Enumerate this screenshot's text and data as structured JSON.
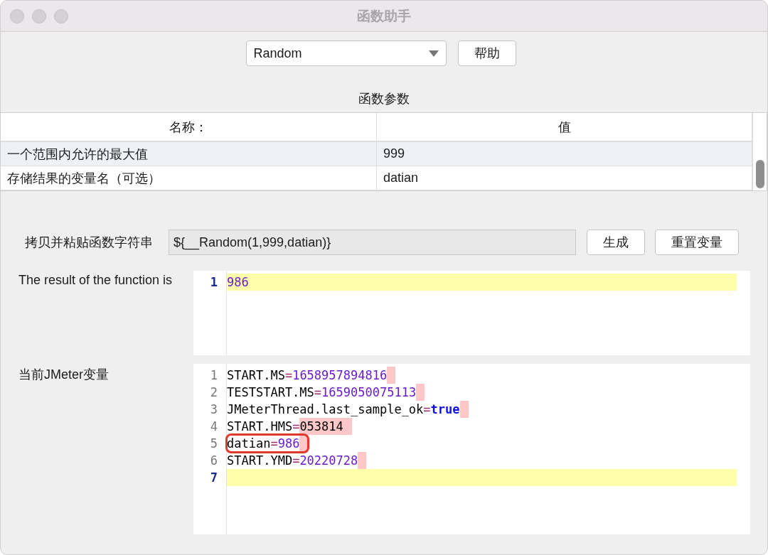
{
  "window": {
    "title": "函数助手"
  },
  "function_select": {
    "value": "Random"
  },
  "help_button": "帮助",
  "parameters": {
    "title": "函数参数",
    "columns": [
      "名称：",
      "值"
    ],
    "rows": [
      {
        "name": "一个范围内允许的最大值",
        "value": "999",
        "selected": true
      },
      {
        "name": "存储结果的变量名（可选）",
        "value": "datian",
        "selected": false
      }
    ]
  },
  "function_string": {
    "label": "拷贝并粘贴函数字符串",
    "value": "${__Random(1,999,datian)}"
  },
  "generate_button": "生成",
  "reset_button": "重置变量",
  "result": {
    "label": "The result of the function is",
    "lines": [
      {
        "number": "1",
        "value": "986",
        "kind": "number",
        "current": true,
        "trailing_space": false,
        "circled": false
      }
    ]
  },
  "variables": {
    "label": "当前JMeter变量",
    "lines": [
      {
        "number": "1",
        "key": "START.MS",
        "sep": "=",
        "value": "1658957894816",
        "kind": "number",
        "current": false,
        "trailing_space": true,
        "circled": false
      },
      {
        "number": "2",
        "key": "TESTSTART.MS",
        "sep": "=",
        "value": "1659050075113",
        "kind": "number",
        "current": false,
        "trailing_space": true,
        "circled": false
      },
      {
        "number": "3",
        "key": "JMeterThread.last_sample_ok",
        "sep": "=",
        "value": "true",
        "kind": "keyword",
        "current": false,
        "trailing_space": true,
        "circled": false
      },
      {
        "number": "4",
        "key": "START.HMS",
        "sep": "=",
        "value": "053814",
        "kind": "string",
        "current": false,
        "trailing_space": true,
        "circled": false
      },
      {
        "number": "5",
        "key": "datian",
        "sep": "=",
        "value": "986",
        "kind": "number",
        "current": false,
        "trailing_space": true,
        "circled": true
      },
      {
        "number": "6",
        "key": "START.YMD",
        "sep": "=",
        "value": "20220728",
        "kind": "number",
        "current": false,
        "trailing_space": true,
        "circled": false
      },
      {
        "number": "7",
        "current": true
      }
    ]
  }
}
